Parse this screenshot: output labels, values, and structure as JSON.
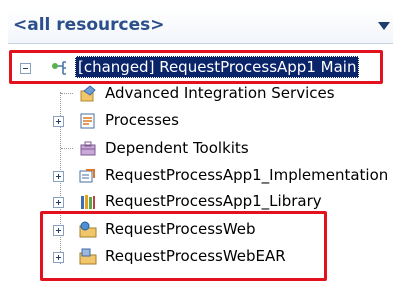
{
  "header": {
    "title": "<all resources>",
    "dropdown_icon": "chevron-down-icon"
  },
  "tree": {
    "root": {
      "label": "[changed] RequestProcessApp1 Main",
      "expanded": true,
      "icon": "process-app-icon"
    },
    "children": [
      {
        "label": "Advanced Integration Services",
        "expandable": false,
        "icon": "integration-services-icon"
      },
      {
        "label": "Processes",
        "expandable": true,
        "icon": "processes-icon"
      },
      {
        "label": "Dependent Toolkits",
        "expandable": false,
        "icon": "toolkits-icon"
      },
      {
        "label": "RequestProcessApp1_Implementation",
        "expandable": true,
        "icon": "implementation-module-icon"
      },
      {
        "label": "RequestProcessApp1_Library",
        "expandable": true,
        "icon": "library-icon"
      },
      {
        "label": "RequestProcessWeb",
        "expandable": true,
        "icon": "web-project-icon"
      },
      {
        "label": "RequestProcessWebEAR",
        "expandable": true,
        "icon": "ear-project-icon"
      }
    ]
  },
  "highlight_color": "#e3101d",
  "selection_color": "#0a246a"
}
